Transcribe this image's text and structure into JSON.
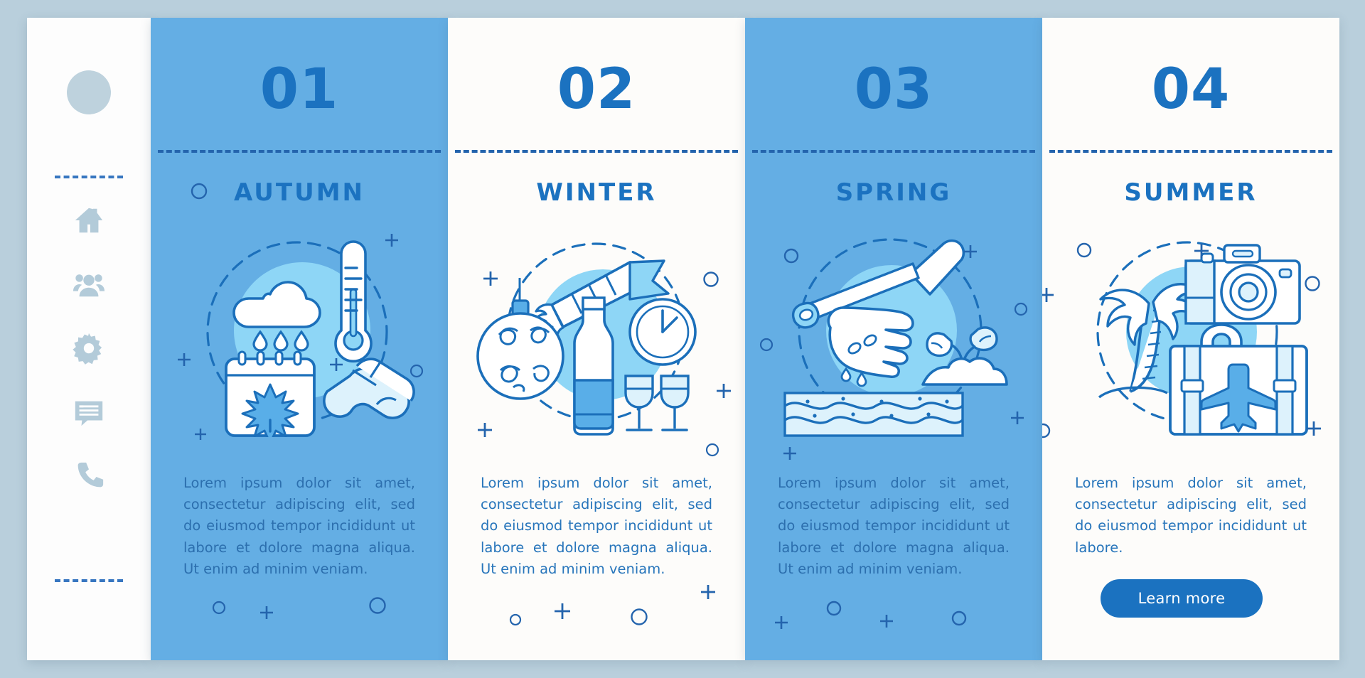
{
  "theme": {
    "page_background": "#b9cfdc",
    "card_blue": "#64aee4",
    "card_white": "#fdfcfa",
    "accent_blue": "#1b72c0",
    "accent_dark": "#2464ad",
    "icon_grey_blue": "#b3cbd9",
    "avatar_grey": "#bed2dd",
    "art_light": "#7fd3f5"
  },
  "sidebar": {
    "avatar": {
      "name": "avatar"
    },
    "divider_top": "dashed-divider-top",
    "divider_bottom": "dashed-divider-bottom",
    "items": [
      {
        "icon": "home-icon",
        "label": "Home"
      },
      {
        "icon": "users-icon",
        "label": "Users"
      },
      {
        "icon": "gear-icon",
        "label": "Settings"
      },
      {
        "icon": "messages-icon",
        "label": "Messages"
      },
      {
        "icon": "phone-icon",
        "label": "Contact"
      }
    ]
  },
  "cards": [
    {
      "number": "01",
      "title": "AUTUMN",
      "body": "Lorem ipsum dolor sit amet, consectetur adipiscing elit, sed do eiusmod tempor incididunt ut labore et dolore magna aliqua. Ut enim ad minim veniam.",
      "style": "blue",
      "illustration": "autumn-illustration",
      "illustration_items": [
        "rain-cloud",
        "thermometer",
        "calendar-with-maple-leaf",
        "socks"
      ],
      "button": null
    },
    {
      "number": "02",
      "title": "WINTER",
      "body": "Lorem ipsum dolor sit amet, consectetur adipiscing elit, sed do eiusmod tempor incididunt ut labore et dolore magna aliqua. Ut enim ad minim veniam.",
      "style": "white",
      "illustration": "winter-illustration",
      "illustration_items": [
        "christmas-ball",
        "firework-rocket",
        "champagne-bottle",
        "clock",
        "champagne-glasses"
      ],
      "button": null
    },
    {
      "number": "03",
      "title": "SPRING",
      "body": "Lorem ipsum dolor sit amet, consectetur adipiscing elit, sed do eiusmod tempor incididunt ut labore et dolore magna aliqua. Ut enim ad minim veniam.",
      "style": "blue",
      "illustration": "spring-illustration",
      "illustration_items": [
        "shovel",
        "sowing-hand",
        "sprout",
        "soil-layers"
      ],
      "button": null
    },
    {
      "number": "04",
      "title": "SUMMER",
      "body": "Lorem ipsum dolor sit amet, consectetur adipiscing elit, sed do eiusmod tempor incididunt ut labore.",
      "style": "white",
      "illustration": "summer-illustration",
      "illustration_items": [
        "palm-tree",
        "photo-camera",
        "suitcase-with-airplane"
      ],
      "button": "Learn more"
    }
  ]
}
